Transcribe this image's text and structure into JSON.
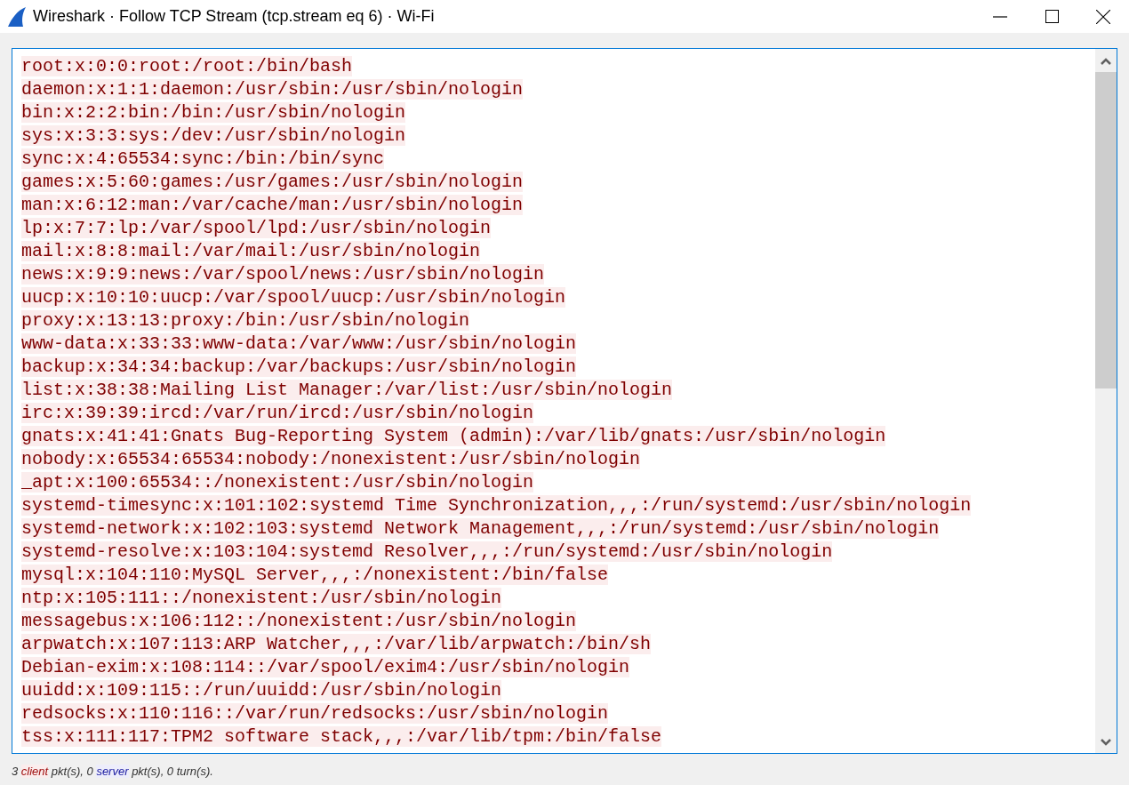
{
  "window": {
    "title": "Wireshark · Follow TCP Stream (tcp.stream eq 6) · Wi-Fi"
  },
  "stream": {
    "lines": [
      {
        "kind": "client",
        "text": "root:x:0:0:root:/root:/bin/bash"
      },
      {
        "kind": "client",
        "text": "daemon:x:1:1:daemon:/usr/sbin:/usr/sbin/nologin"
      },
      {
        "kind": "client",
        "text": "bin:x:2:2:bin:/bin:/usr/sbin/nologin"
      },
      {
        "kind": "client",
        "text": "sys:x:3:3:sys:/dev:/usr/sbin/nologin"
      },
      {
        "kind": "client",
        "text": "sync:x:4:65534:sync:/bin:/bin/sync"
      },
      {
        "kind": "client",
        "text": "games:x:5:60:games:/usr/games:/usr/sbin/nologin"
      },
      {
        "kind": "client",
        "text": "man:x:6:12:man:/var/cache/man:/usr/sbin/nologin"
      },
      {
        "kind": "client",
        "text": "lp:x:7:7:lp:/var/spool/lpd:/usr/sbin/nologin"
      },
      {
        "kind": "client",
        "text": "mail:x:8:8:mail:/var/mail:/usr/sbin/nologin"
      },
      {
        "kind": "client",
        "text": "news:x:9:9:news:/var/spool/news:/usr/sbin/nologin"
      },
      {
        "kind": "client",
        "text": "uucp:x:10:10:uucp:/var/spool/uucp:/usr/sbin/nologin"
      },
      {
        "kind": "client",
        "text": "proxy:x:13:13:proxy:/bin:/usr/sbin/nologin"
      },
      {
        "kind": "client",
        "text": "www-data:x:33:33:www-data:/var/www:/usr/sbin/nologin"
      },
      {
        "kind": "client",
        "text": "backup:x:34:34:backup:/var/backups:/usr/sbin/nologin"
      },
      {
        "kind": "client",
        "text": "list:x:38:38:Mailing List Manager:/var/list:/usr/sbin/nologin"
      },
      {
        "kind": "client",
        "text": "irc:x:39:39:ircd:/var/run/ircd:/usr/sbin/nologin"
      },
      {
        "kind": "client",
        "text": "gnats:x:41:41:Gnats Bug-Reporting System (admin):/var/lib/gnats:/usr/sbin/nologin"
      },
      {
        "kind": "client",
        "text": "nobody:x:65534:65534:nobody:/nonexistent:/usr/sbin/nologin"
      },
      {
        "kind": "client",
        "text": "_apt:x:100:65534::/nonexistent:/usr/sbin/nologin"
      },
      {
        "kind": "client",
        "text": "systemd-timesync:x:101:102:systemd Time Synchronization,,,:/run/systemd:/usr/sbin/nologin"
      },
      {
        "kind": "client",
        "text": "systemd-network:x:102:103:systemd Network Management,,,:/run/systemd:/usr/sbin/nologin"
      },
      {
        "kind": "client",
        "text": "systemd-resolve:x:103:104:systemd Resolver,,,:/run/systemd:/usr/sbin/nologin"
      },
      {
        "kind": "client",
        "text": "mysql:x:104:110:MySQL Server,,,:/nonexistent:/bin/false"
      },
      {
        "kind": "client",
        "text": "ntp:x:105:111::/nonexistent:/usr/sbin/nologin"
      },
      {
        "kind": "client",
        "text": "messagebus:x:106:112::/nonexistent:/usr/sbin/nologin"
      },
      {
        "kind": "client",
        "text": "arpwatch:x:107:113:ARP Watcher,,,:/var/lib/arpwatch:/bin/sh"
      },
      {
        "kind": "client",
        "text": "Debian-exim:x:108:114::/var/spool/exim4:/usr/sbin/nologin"
      },
      {
        "kind": "client",
        "text": "uuidd:x:109:115::/run/uuidd:/usr/sbin/nologin"
      },
      {
        "kind": "client",
        "text": "redsocks:x:110:116::/var/run/redsocks:/usr/sbin/nologin"
      },
      {
        "kind": "client",
        "text": "tss:x:111:117:TPM2 software stack,,,:/var/lib/tpm:/bin/false"
      }
    ]
  },
  "status_bar": [
    {
      "kind": "plain",
      "text": "3 "
    },
    {
      "kind": "client",
      "text": "client"
    },
    {
      "kind": "plain",
      "text": " pkt(s), 0 "
    },
    {
      "kind": "server",
      "text": "server"
    },
    {
      "kind": "plain",
      "text": " pkt(s), 0 turn(s)."
    }
  ]
}
